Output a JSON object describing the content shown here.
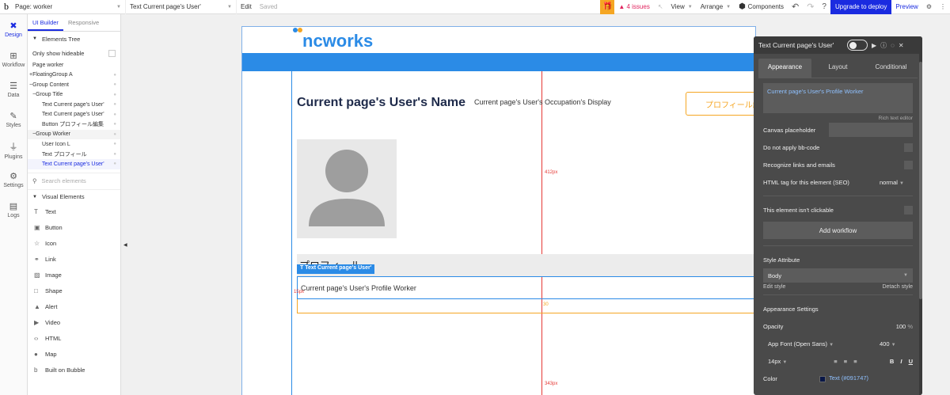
{
  "topbar": {
    "logo": "b",
    "page_select": "Page: worker",
    "element_select": "Text Current page's User'",
    "edit": "Edit",
    "saved": "Saved",
    "issues": "4 issues",
    "view": "View",
    "arrange": "Arrange",
    "components": "Components",
    "upgrade": "Upgrade to deploy",
    "preview": "Preview"
  },
  "rail": [
    {
      "label": "Design",
      "icon": "design-icon",
      "active": true
    },
    {
      "label": "Workflow",
      "icon": "workflow-icon"
    },
    {
      "label": "Data",
      "icon": "data-icon"
    },
    {
      "label": "Styles",
      "icon": "styles-icon"
    },
    {
      "label": "Plugins",
      "icon": "plugins-icon"
    },
    {
      "label": "Settings",
      "icon": "settings-icon"
    },
    {
      "label": "Logs",
      "icon": "logs-icon"
    }
  ],
  "left_panel": {
    "tabs": [
      "UI Builder",
      "Responsive"
    ],
    "tree_title": "Elements Tree",
    "only_show_hideable": "Only show hideable",
    "tree": [
      {
        "label": "Page worker",
        "indent": 0
      },
      {
        "label": "+FloatingGroup A",
        "indent": 0
      },
      {
        "label": "−Group Content",
        "indent": 0
      },
      {
        "label": "−Group Title",
        "indent": 1
      },
      {
        "label": "Text Current page's User'",
        "indent": 2
      },
      {
        "label": "Text Current page's User'",
        "indent": 2
      },
      {
        "label": "Button プロフィール編集",
        "indent": 2
      },
      {
        "label": "−Group Worker",
        "indent": 1
      },
      {
        "label": "User Icon L",
        "indent": 2
      },
      {
        "label": "Text プロフィール",
        "indent": 2
      },
      {
        "label": "Text Current page's User'",
        "indent": 2
      }
    ],
    "search_placeholder": "Search elements",
    "visual_title": "Visual Elements",
    "visual": [
      {
        "label": "Text",
        "icon": "T"
      },
      {
        "label": "Button",
        "icon": "▣"
      },
      {
        "label": "Icon",
        "icon": "☆"
      },
      {
        "label": "Link",
        "icon": "⚭"
      },
      {
        "label": "Image",
        "icon": "▨"
      },
      {
        "label": "Shape",
        "icon": "□"
      },
      {
        "label": "Alert",
        "icon": "▲"
      },
      {
        "label": "Video",
        "icon": "▶"
      },
      {
        "label": "HTML",
        "icon": "‹›"
      },
      {
        "label": "Map",
        "icon": "●"
      },
      {
        "label": "Built on Bubble",
        "icon": "b"
      }
    ]
  },
  "canvas": {
    "logo_text": "ncworks",
    "user_name": "Current page's User's Name",
    "occupation": "Current page's User's Occupation's Display",
    "profile_button": "プロフィール編",
    "profile_heading": "プロフィール",
    "selected_label": "Text Current page's User'",
    "profile_text": "Current page's User's Profile Worker",
    "measure_412": "412px",
    "measure_343": "343px",
    "measure_15": "15px",
    "measure_30": "30"
  },
  "prop": {
    "title": "Text Current page's User'",
    "tabs": [
      "Appearance",
      "Layout",
      "Conditional"
    ],
    "rich_text": "Current page's User's Profile Worker",
    "rich_text_note": "Rich text editor",
    "canvas_placeholder": "Canvas placeholder",
    "no_bbcode": "Do not apply bb-code",
    "recognize_links": "Recognize links and emails",
    "html_tag": "HTML tag for this element (SEO)",
    "html_tag_value": "normal",
    "not_clickable": "This element isn't clickable",
    "add_workflow": "Add workflow",
    "style_attribute": "Style Attribute",
    "style_value": "Body",
    "edit_style": "Edit style",
    "detach_style": "Detach style",
    "appearance_settings": "Appearance Settings",
    "opacity": "Opacity",
    "opacity_value": "100",
    "opacity_unit": "%",
    "font": "App Font (Open Sans)",
    "weight": "400",
    "size": "14px",
    "color_label": "Color",
    "color_value": "Text (#091747)",
    "color_hex": "#091747"
  },
  "colors": {
    "accent": "#1a2be0",
    "brand_blue": "#2b8be6",
    "orange": "#f5a623",
    "guide_red": "#e53935"
  }
}
